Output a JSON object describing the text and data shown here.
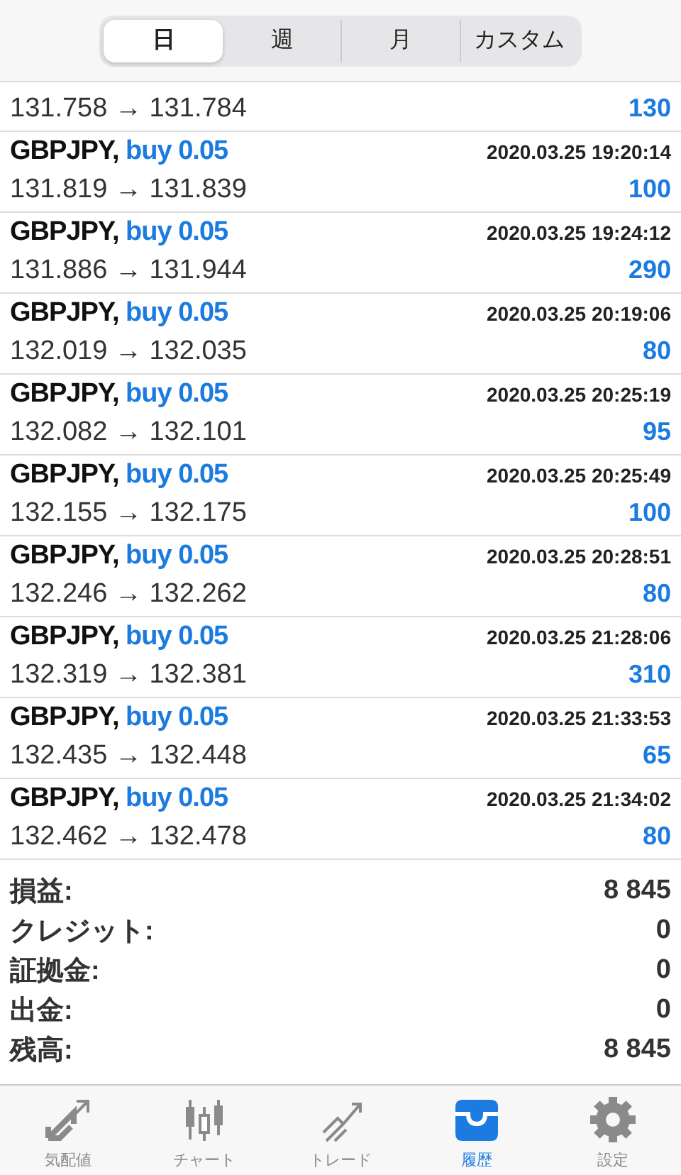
{
  "periods": [
    {
      "label": "日",
      "selected": true
    },
    {
      "label": "週",
      "selected": false
    },
    {
      "label": "月",
      "selected": false
    },
    {
      "label": "カスタム",
      "selected": false
    }
  ],
  "deals": [
    {
      "prices": "131.758 → 131.784",
      "profit": "130"
    },
    {
      "symbol": "GBPJPY,",
      "type": "buy 0.05",
      "time": "2020.03.25 19:20:14",
      "prices": "131.819 → 131.839",
      "profit": "100"
    },
    {
      "symbol": "GBPJPY,",
      "type": "buy 0.05",
      "time": "2020.03.25 19:24:12",
      "prices": "131.886 → 131.944",
      "profit": "290"
    },
    {
      "symbol": "GBPJPY,",
      "type": "buy 0.05",
      "time": "2020.03.25 20:19:06",
      "prices": "132.019 → 132.035",
      "profit": "80"
    },
    {
      "symbol": "GBPJPY,",
      "type": "buy 0.05",
      "time": "2020.03.25 20:25:19",
      "prices": "132.082 → 132.101",
      "profit": "95"
    },
    {
      "symbol": "GBPJPY,",
      "type": "buy 0.05",
      "time": "2020.03.25 20:25:49",
      "prices": "132.155 → 132.175",
      "profit": "100"
    },
    {
      "symbol": "GBPJPY,",
      "type": "buy 0.05",
      "time": "2020.03.25 20:28:51",
      "prices": "132.246 → 132.262",
      "profit": "80"
    },
    {
      "symbol": "GBPJPY,",
      "type": "buy 0.05",
      "time": "2020.03.25 21:28:06",
      "prices": "132.319 → 132.381",
      "profit": "310"
    },
    {
      "symbol": "GBPJPY,",
      "type": "buy 0.05",
      "time": "2020.03.25 21:33:53",
      "prices": "132.435 → 132.448",
      "profit": "65"
    },
    {
      "symbol": "GBPJPY,",
      "type": "buy 0.05",
      "time": "2020.03.25 21:34:02",
      "prices": "132.462 → 132.478",
      "profit": "80"
    }
  ],
  "summary": [
    {
      "label": "損益:",
      "value": "8 845"
    },
    {
      "label": "クレジット:",
      "value": "0"
    },
    {
      "label": "証拠金:",
      "value": "0"
    },
    {
      "label": "出金:",
      "value": "0"
    },
    {
      "label": "残高:",
      "value": "8 845"
    }
  ],
  "tabbar": [
    {
      "kind": "quotes",
      "label": "気配値",
      "selected": false
    },
    {
      "kind": "chart",
      "label": "チャート",
      "selected": false
    },
    {
      "kind": "trade",
      "label": "トレード",
      "selected": false
    },
    {
      "kind": "history",
      "label": "履歴",
      "selected": true
    },
    {
      "kind": "settings",
      "label": "設定",
      "selected": false
    }
  ]
}
